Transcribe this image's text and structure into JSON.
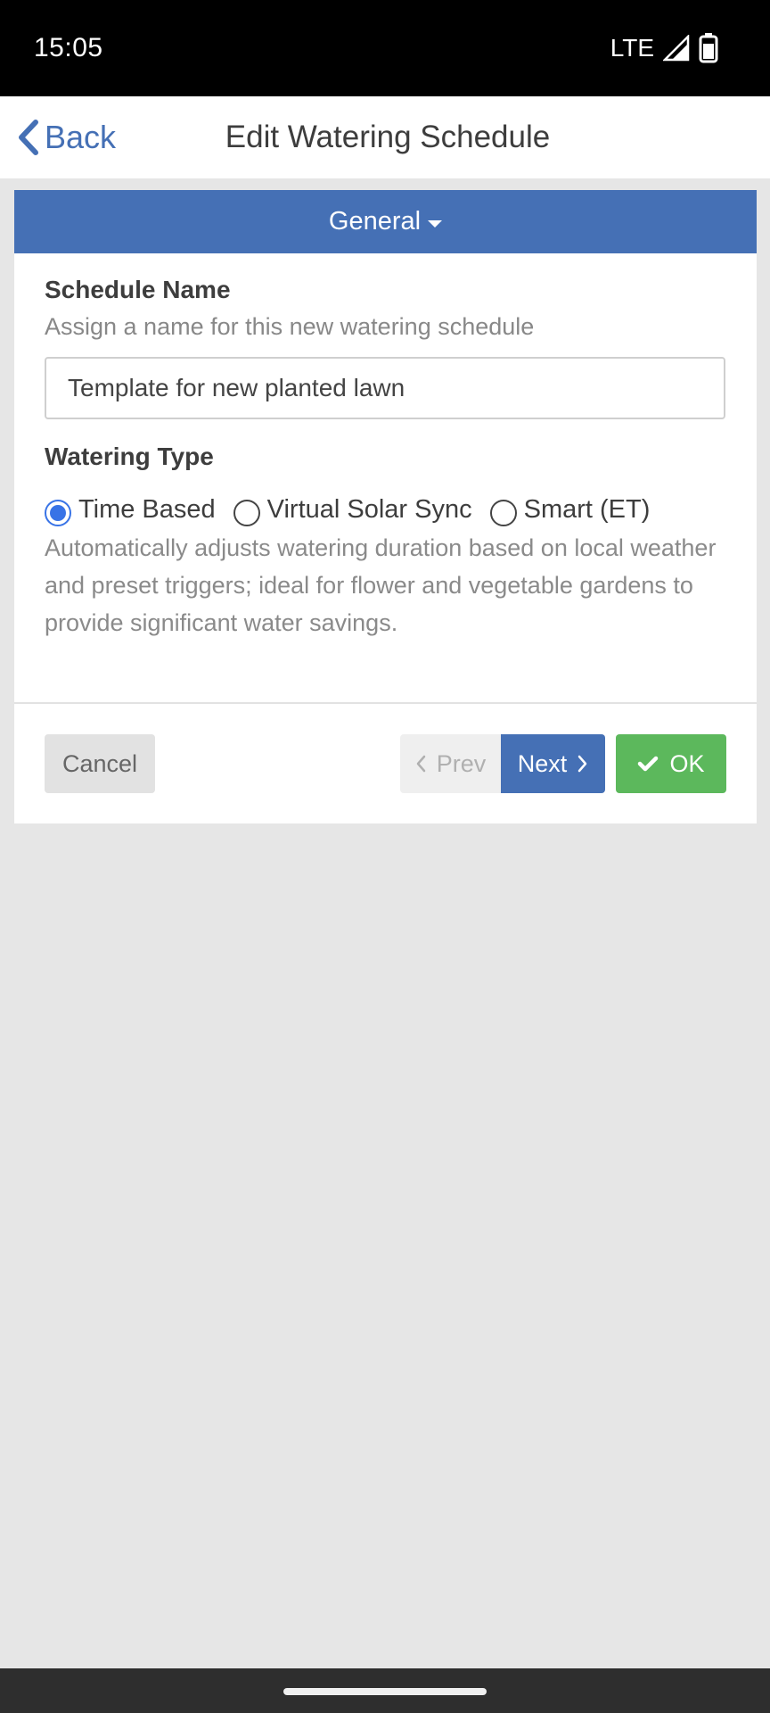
{
  "status_bar": {
    "time": "15:05",
    "network": "LTE",
    "signal_icon": "signal-icon",
    "battery_icon": "battery-icon"
  },
  "nav": {
    "back_label": "Back",
    "back_icon": "chevron-left-icon",
    "title": "Edit Watering Schedule"
  },
  "section": {
    "label": "General",
    "icon": "caret-down-icon"
  },
  "form": {
    "schedule_name": {
      "label": "Schedule Name",
      "hint": "Assign a name for this new watering schedule",
      "value": "Template for new planted lawn"
    },
    "watering_type": {
      "label": "Watering Type",
      "options": [
        {
          "label": "Time Based",
          "selected": true
        },
        {
          "label": "Virtual Solar Sync",
          "selected": false
        },
        {
          "label": "Smart (ET)",
          "selected": false
        }
      ],
      "description": "Automatically adjusts watering duration based on local weather and preset triggers; ideal for flower and vegetable gardens to provide significant water savings."
    }
  },
  "buttons": {
    "cancel": "Cancel",
    "prev": "Prev",
    "next": "Next",
    "ok": "OK"
  },
  "colors": {
    "accent": "#4570b5",
    "ok_green": "#5cb85c",
    "radio_selected": "#3873e6"
  }
}
